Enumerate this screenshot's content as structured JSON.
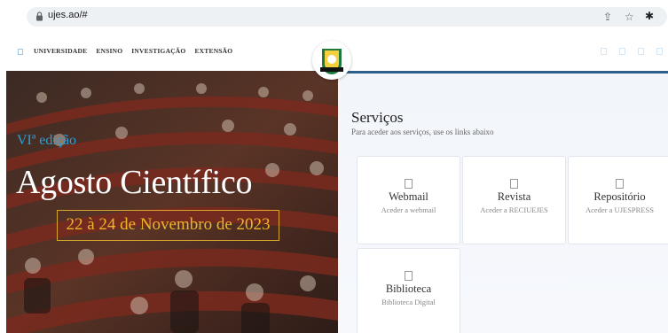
{
  "browser": {
    "url": "ujes.ao/#",
    "icons": [
      "lock-icon",
      "share-icon",
      "star-icon",
      "extensions-icon"
    ]
  },
  "nav": {
    "items": [
      {
        "label": "UNIVERSIDADE"
      },
      {
        "label": "ENSINO"
      },
      {
        "label": "INVESTIGAÇÃO"
      },
      {
        "label": "EXTENSÃO"
      }
    ]
  },
  "hero": {
    "subtitle": "VIª edição",
    "title": "Agosto Científico",
    "dates": "22 à 24 de Novembro de 2023"
  },
  "services": {
    "title": "Serviços",
    "subtitle": "Para aceder aos serviços, use os links abaixo",
    "cards": [
      {
        "title": "Webmail",
        "description": "Aceder a webmail"
      },
      {
        "title": "Revista",
        "description": "Aceder a RECIUEJES"
      },
      {
        "title": "Repositório",
        "description": "Aceder a UJESPRESS"
      },
      {
        "title": "Biblioteca",
        "description": "Biblioteca Digital"
      }
    ]
  },
  "colors": {
    "accent_blue": "#2aa0d8",
    "accent_gold": "#f0b429",
    "panel_bg": "#f2f5fa"
  }
}
